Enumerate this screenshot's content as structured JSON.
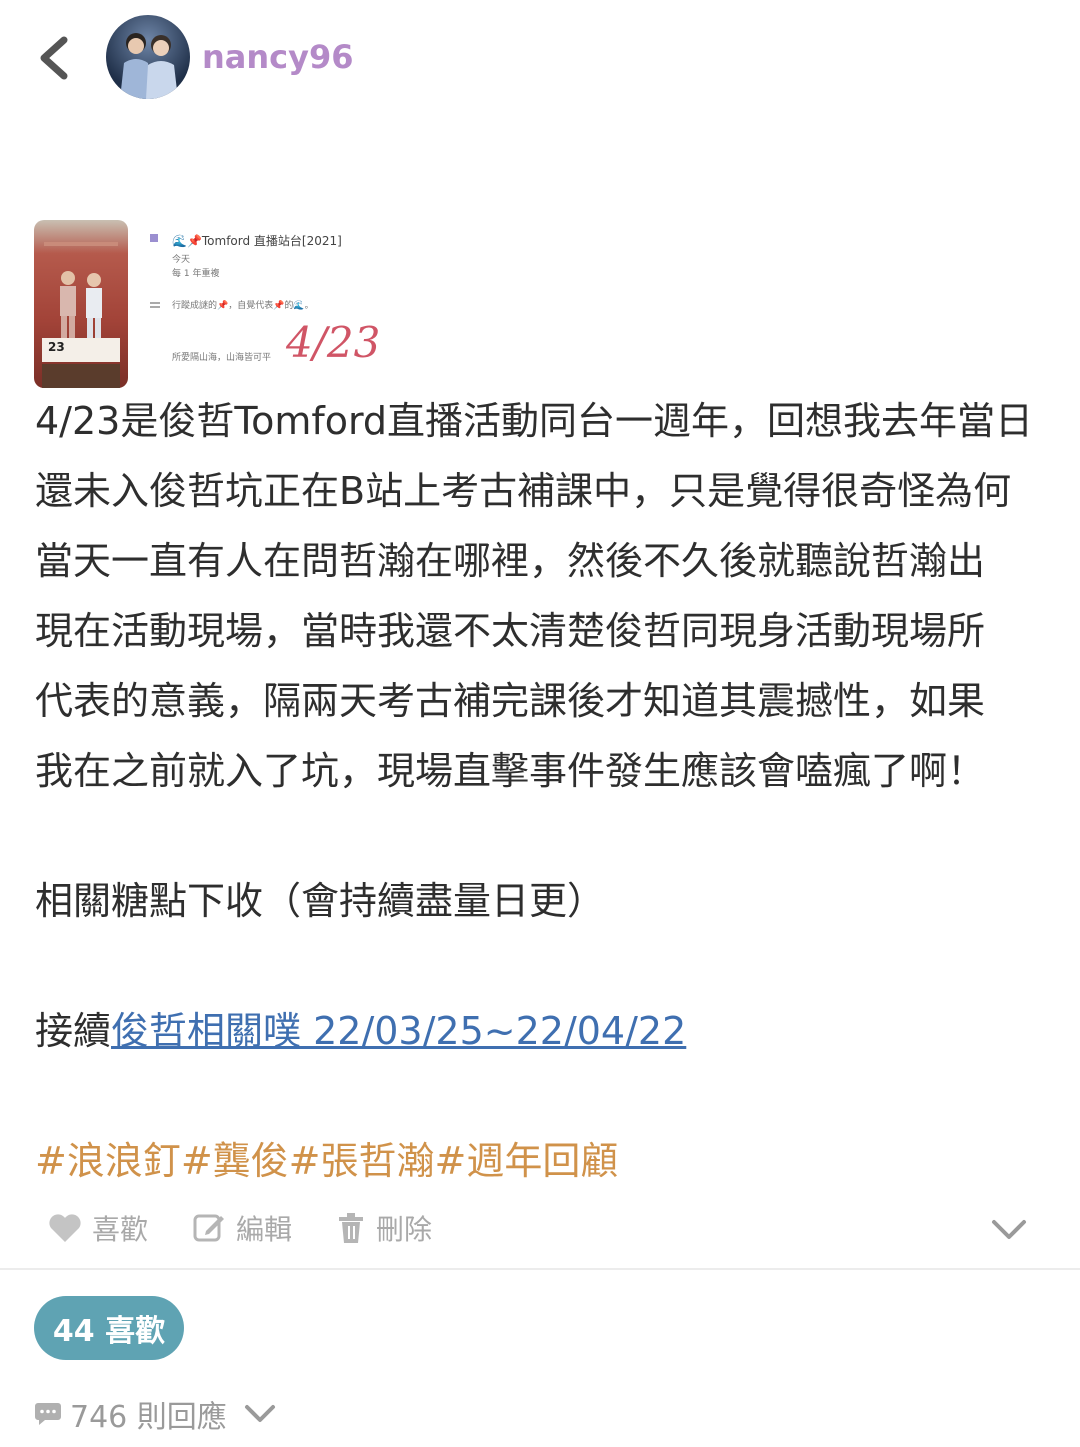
{
  "header": {
    "username": "nancy96"
  },
  "note": {
    "title": "🌊📌Tomford 直播站台[2021]",
    "line1": "今天",
    "line2": "每 1 年重複",
    "line3": "行蹤成謎的📌，自覺代表📌的🌊。",
    "line4": "所愛隔山海，山海皆可平",
    "date": "4/23",
    "photo_num": "23"
  },
  "post": {
    "paragraph": [
      "4/23是俊哲Tomford直播活動同台一週年，回想我去年當日",
      "還未入俊哲坑正在B站上考古補課中，只是覺得很奇怪為何",
      "當天一直有人在問哲瀚在哪裡，然後不久後就聽說哲瀚出",
      "現在活動現場，當時我還不太清楚俊哲同現身活動現場所",
      "代表的意義，隔兩天考古補完課後才知道其震撼性，如果",
      "我在之前就入了坑，現場直擊事件發生應該會嗑瘋了啊！"
    ],
    "related": "相關糖點下收（會持續盡量日更）",
    "continue_prefix": "接續",
    "continue_link": "俊哲相關噗 22/03/25~22/04/22",
    "tags": "#浪浪釘#龔俊#張哲瀚#週年回顧"
  },
  "actions": {
    "like": "喜歡",
    "edit": "編輯",
    "delete": "刪除"
  },
  "footer": {
    "likes_badge": "44 喜歡",
    "replies": "746 則回應"
  },
  "colors": {
    "accent_username": "#b48ac8",
    "link": "#3f6fb0",
    "tags": "#d0924a",
    "badge_bg": "#5fa3b3"
  }
}
